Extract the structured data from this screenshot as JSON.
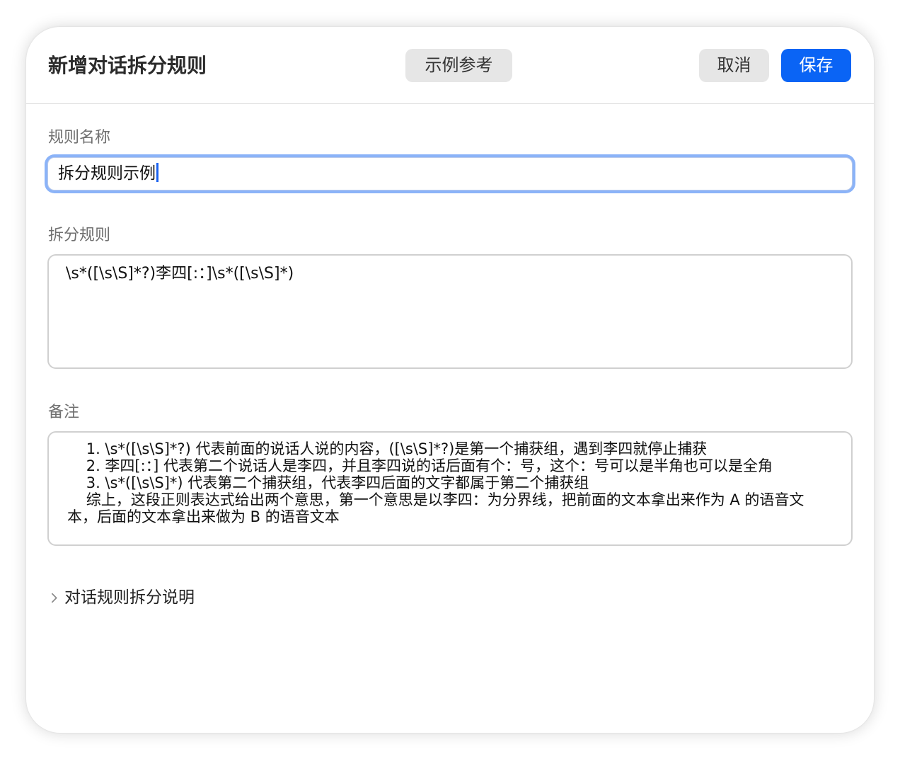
{
  "dialog": {
    "title": "新增对话拆分规则",
    "example_button": "示例参考",
    "cancel_button": "取消",
    "save_button": "保存"
  },
  "rule_name": {
    "label": "规则名称",
    "value": "拆分规则示例"
  },
  "split_rule": {
    "label": "拆分规则",
    "value": "\\s*([\\s\\S]*?)李四[:：]\\s*([\\s\\S]*)"
  },
  "note": {
    "label": "备注",
    "lines": [
      "    1. \\s*([\\s\\S]*?) 代表前面的说话人说的内容，([\\s\\S]*?)是第一个捕获组，遇到李四就停止捕获",
      "    2. 李四[:：] 代表第二个说话人是李四，并且李四说的话后面有个：号，这个：号可以是半角也可以是全角",
      "    3. \\s*([\\s\\S]*) 代表第二个捕获组，代表李四后面的文字都属于第二个捕获组",
      "    综上，这段正则表达式给出两个意思，第一个意思是以李四：为分界线，把前面的文本拿出来作为 A 的语音文本，后面的文本拿出来做为 B 的语音文本"
    ]
  },
  "expander": {
    "label": "对话规则拆分说明",
    "icon": "chevron-right-icon"
  },
  "colors": {
    "primary": "#0a64f5",
    "secondary_button": "#e6e6e6",
    "focus_ring": "#8bb3f8"
  }
}
